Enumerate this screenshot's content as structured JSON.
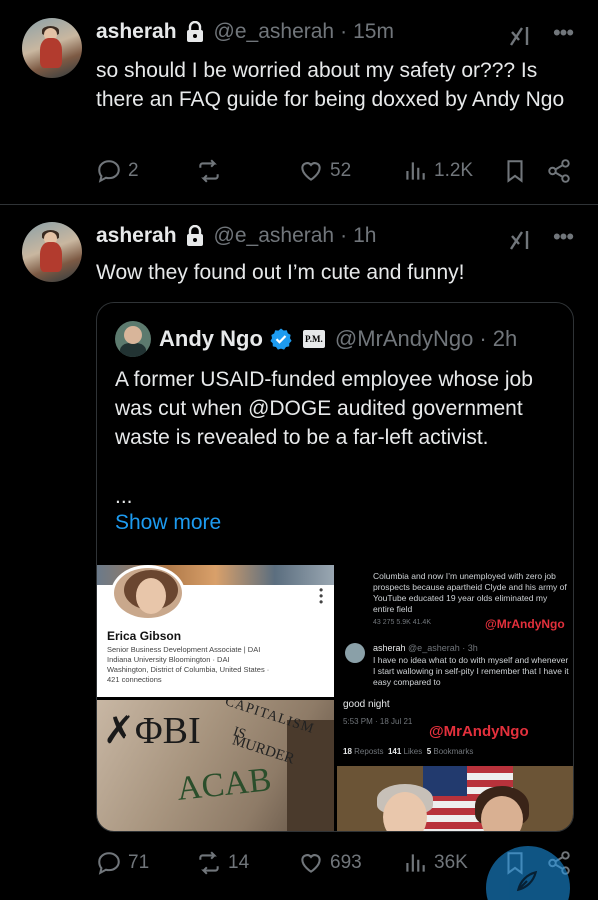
{
  "tweets": [
    {
      "name": "asherah",
      "handle": "@e_asherah",
      "separator": "·",
      "time": "15m",
      "text": "so should I be worried about my safety or??? Is there an FAQ guide for being doxxed by Andy Ngo",
      "replies": "2",
      "reposts": "",
      "likes": "52",
      "views": "1.2K"
    },
    {
      "name": "asherah",
      "handle": "@e_asherah",
      "separator": "·",
      "time": "1h",
      "text": "Wow they found out I’m cute and funny!",
      "replies": "71",
      "reposts": "14",
      "likes": "693",
      "views": "36K"
    }
  ],
  "quote": {
    "name": "Andy Ngo",
    "badge": "P.M.",
    "handle": "@MrAndyNgo",
    "separator": "·",
    "time": "2h",
    "text": "A former USAID-funded employee whose job was cut when @DOGE audited government waste is revealed to be a far-left activist.",
    "ellipsis": "...",
    "show_more": "Show more",
    "media": {
      "profile": {
        "name": "Erica Gibson",
        "title": "Senior Business Development Associate | DAI",
        "school": "Indiana University Bloomington · DAI",
        "location": "Washington, District of Columbia, United States ·",
        "connections": "421 connections"
      },
      "graffiti": {
        "line1": "CAPITALISM",
        "line2": "IS",
        "line3": "MURDER",
        "tag": "ACAB"
      },
      "screenshot": {
        "post_text": "Columbia and now I’m unemployed with zero job prospects because apartheid Clyde and his army of YouTube educated 19 year olds eliminated my entire field",
        "post_meta": "43   275   5.9K   41.4K",
        "watermark": "@MrAndyNgo",
        "reply_name": "asherah",
        "reply_handle": "@e_asherah · 3h",
        "reply_text": "I have no idea what to do with myself and whenever I start wallowing in self-pity I remember that I have it easy compared to",
        "good_night": "good night",
        "timestamp": "5:53 PM · 18 Jul 21",
        "reposts_count": "18",
        "reposts_label": "Reposts",
        "likes_count": "141",
        "likes_label": "Likes",
        "bookmarks_count": "5",
        "bookmarks_label": "Bookmarks"
      }
    }
  },
  "colors": {
    "background": "#000000",
    "text": "#e7e9ea",
    "muted": "#71767b",
    "accent": "#1d9bf0",
    "border": "#2f3336",
    "watermark": "#e3303c"
  },
  "icons": [
    "lock-icon",
    "grok-icon",
    "more-icon",
    "reply-icon",
    "repost-icon",
    "like-icon",
    "views-icon",
    "bookmark-icon",
    "share-icon",
    "verified-icon",
    "compose-icon"
  ]
}
